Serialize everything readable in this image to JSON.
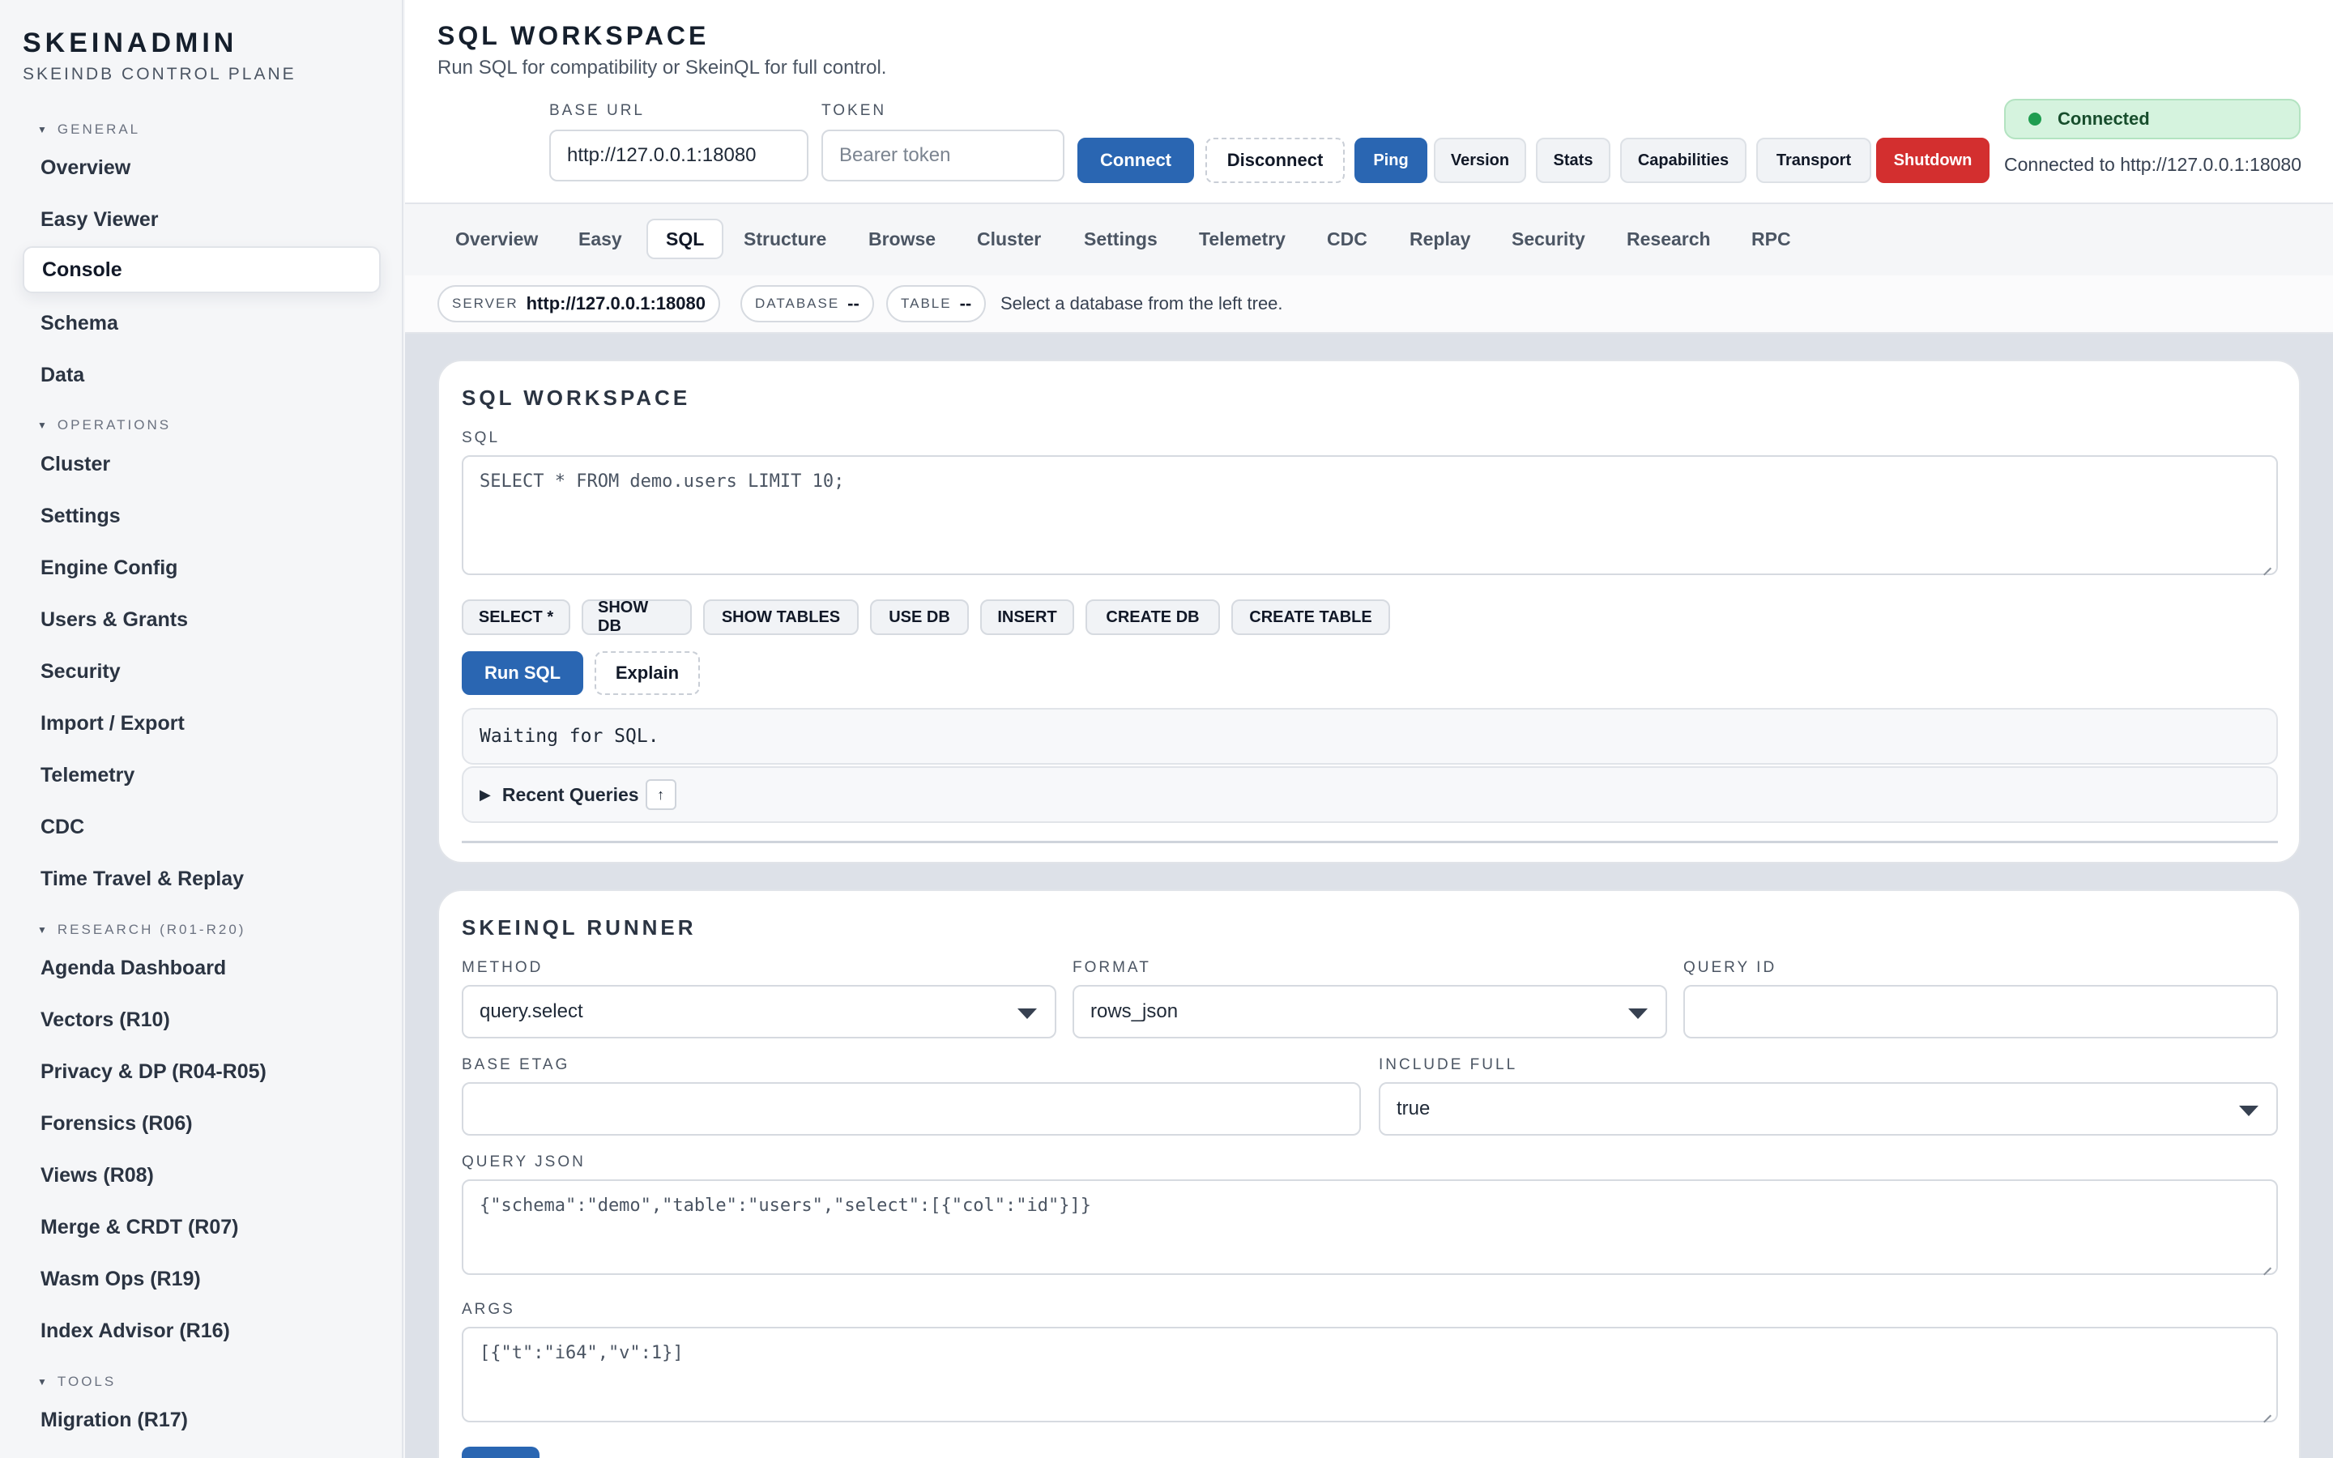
{
  "sidebar": {
    "brand_title": "SKEINADMIN",
    "brand_subtitle": "SKEINDB CONTROL PLANE",
    "groups": [
      {
        "label": "GENERAL",
        "items": [
          "Overview",
          "Easy Viewer",
          "Console",
          "Schema",
          "Data"
        ]
      },
      {
        "label": "OPERATIONS",
        "items": [
          "Cluster",
          "Settings",
          "Engine Config",
          "Users & Grants",
          "Security",
          "Import / Export",
          "Telemetry",
          "CDC",
          "Time Travel & Replay"
        ]
      },
      {
        "label": "RESEARCH (R01-R20)",
        "items": [
          "Agenda Dashboard",
          "Vectors (R10)",
          "Privacy & DP (R04-R05)",
          "Forensics (R06)",
          "Views (R08)",
          "Merge & CRDT (R07)",
          "Wasm Ops (R19)",
          "Index Advisor (R16)"
        ]
      },
      {
        "label": "TOOLS",
        "items": [
          "Migration (R17)"
        ]
      }
    ],
    "active_item": "Console"
  },
  "header": {
    "title": "SQL WORKSPACE",
    "subtitle": "Run SQL for compatibility or SkeinQL for full control.",
    "base_url_label": "BASE URL",
    "base_url_value": "http://127.0.0.1:18080",
    "token_label": "TOKEN",
    "token_placeholder": "Bearer token",
    "buttons": {
      "connect": "Connect",
      "disconnect": "Disconnect",
      "ping": "Ping",
      "version": "Version",
      "stats": "Stats",
      "capabilities": "Capabilities",
      "transport": "Transport",
      "shutdown": "Shutdown"
    },
    "connection_status": "Connected",
    "connection_info": "Connected to http://127.0.0.1:18080"
  },
  "tabs": [
    "Overview",
    "Easy",
    "SQL",
    "Structure",
    "Browse",
    "Cluster",
    "Settings",
    "Telemetry",
    "CDC",
    "Replay",
    "Security",
    "Research",
    "RPC"
  ],
  "active_tab": "SQL",
  "context": {
    "server_label": "SERVER",
    "server_value": "http://127.0.0.1:18080",
    "database_label": "DATABASE",
    "database_value": "--",
    "table_label": "TABLE",
    "table_value": "--",
    "note": "Select a database from the left tree."
  },
  "sql_card": {
    "title": "SQL WORKSPACE",
    "sql_label": "SQL",
    "sql_value": "SELECT * FROM demo.users LIMIT 10;",
    "snippets": [
      "SELECT *",
      "SHOW DB",
      "SHOW TABLES",
      "USE DB",
      "INSERT",
      "CREATE DB",
      "CREATE TABLE"
    ],
    "run_button": "Run SQL",
    "explain_button": "Explain",
    "status": "Waiting for SQL.",
    "recent_queries": "Recent Queries",
    "recent_icon": "↑"
  },
  "skeinql_card": {
    "title": "SKEINQL RUNNER",
    "method_label": "METHOD",
    "method_value": "query.select",
    "format_label": "FORMAT",
    "format_value": "rows_json",
    "query_id_label": "QUERY ID",
    "query_id_value": "",
    "base_etag_label": "BASE ETAG",
    "base_etag_value": "",
    "include_full_label": "INCLUDE FULL",
    "include_full_value": "true",
    "query_json_label": "QUERY JSON",
    "query_json_value": "{\"schema\":\"demo\",\"table\":\"users\",\"select\":[{\"col\":\"id\"}]}",
    "args_label": "ARGS",
    "args_value": "[{\"t\":\"i64\",\"v\":1}]"
  },
  "colors": {
    "primary": "#2a66b2",
    "danger": "#d32f2f",
    "connected_bg": "#d5f3de",
    "connected_dot": "#1f9d50"
  },
  "icons": {
    "group_chevron": "chevron-down-icon",
    "recent_toggle": "triangle-right-icon",
    "status_dot": "status-dot-icon"
  }
}
